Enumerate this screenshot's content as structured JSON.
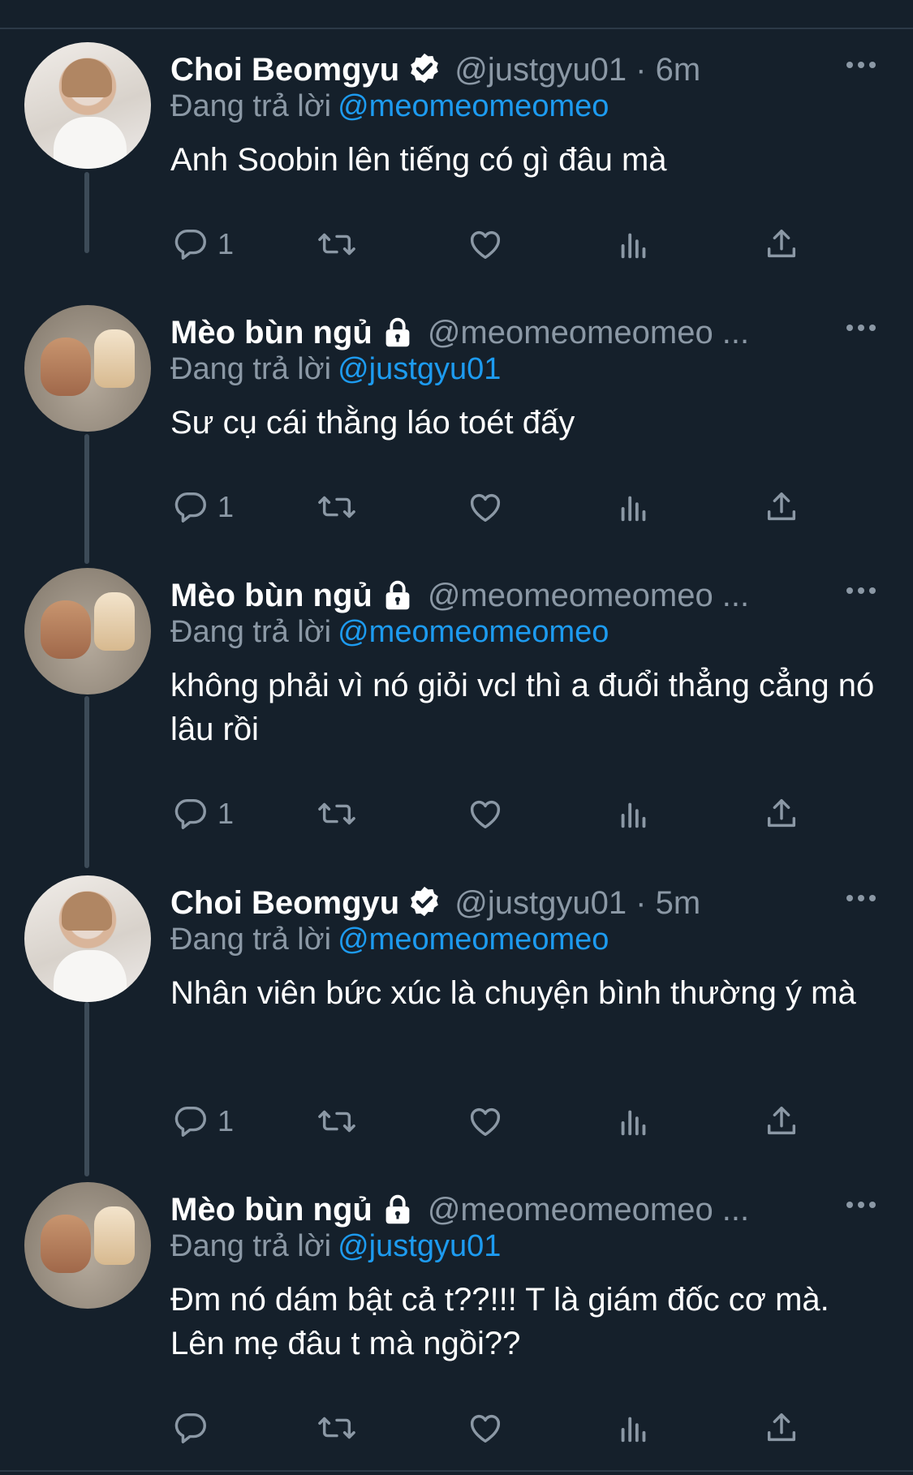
{
  "reply_prefix": "Đang trả lời",
  "tweets": [
    {
      "name": "Choi Beomgyu",
      "verified": true,
      "handle": "@justgyu01 · 6m",
      "reply_to": "@meomeomeomeo",
      "text": "Anh Soobin lên tiếng có gì đâu mà",
      "reply_count": "1",
      "avatar": "person"
    },
    {
      "name": "Mèo bùn ngủ",
      "locked": true,
      "handle": "@meomeomeomeo ...",
      "reply_to": "@justgyu01",
      "text": "Sư cụ cái thằng láo toét đấy",
      "reply_count": "1",
      "avatar": "cat"
    },
    {
      "name": "Mèo bùn ngủ",
      "locked": true,
      "handle": "@meomeomeomeo ...",
      "reply_to": "@meomeomeomeo",
      "text": "không phải vì nó giỏi vcl thì a đuổi thẳng cẳng nó lâu rồi",
      "reply_count": "1",
      "avatar": "cat"
    },
    {
      "name": "Choi Beomgyu",
      "verified": true,
      "handle": "@justgyu01 · 5m",
      "reply_to": "@meomeomeomeo",
      "text": "Nhân viên bức xúc là chuyện bình thường ý mà",
      "reply_count": "1",
      "avatar": "person"
    },
    {
      "name": "Mèo bùn ngủ",
      "locked": true,
      "handle": "@meomeomeomeo ...",
      "reply_to": "@justgyu01",
      "text": "Đm nó dám bật cả t??!!! T là giám đốc cơ mà. Lên mẹ đâu t mà ngồi??",
      "reply_count": "",
      "avatar": "cat"
    }
  ],
  "icons": {
    "verified": "verified-badge-icon",
    "lock": "lock-icon",
    "more": "more-icon",
    "reply": "reply-icon",
    "retweet": "retweet-icon",
    "like": "like-icon",
    "views": "views-icon",
    "share": "share-icon"
  },
  "colors": {
    "background": "#15202b",
    "secondary": "#8b98a5",
    "link": "#1d9bf0"
  }
}
